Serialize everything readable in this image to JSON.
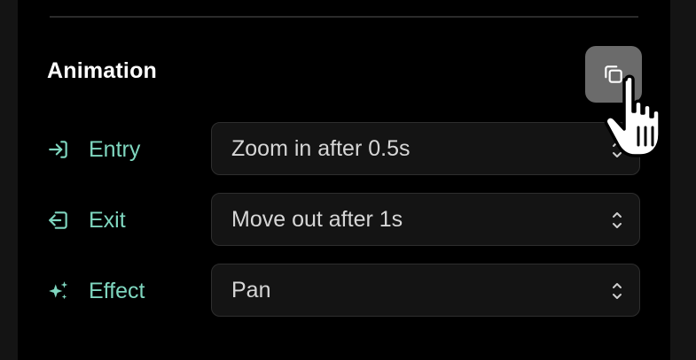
{
  "section": {
    "title": "Animation"
  },
  "copy_button": {
    "icon": "copy-icon"
  },
  "rows": [
    {
      "label": "Entry",
      "icon": "entry-icon",
      "value": "Zoom in after 0.5s"
    },
    {
      "label": "Exit",
      "icon": "exit-icon",
      "value": "Move out after 1s"
    },
    {
      "label": "Effect",
      "icon": "sparkle-icon",
      "value": "Pan"
    }
  ],
  "colors": {
    "background": "#000000",
    "accent": "#7fd6bf",
    "select_bg": "#141414",
    "button_bg": "#6b6b6b",
    "text": "#ffffff"
  }
}
